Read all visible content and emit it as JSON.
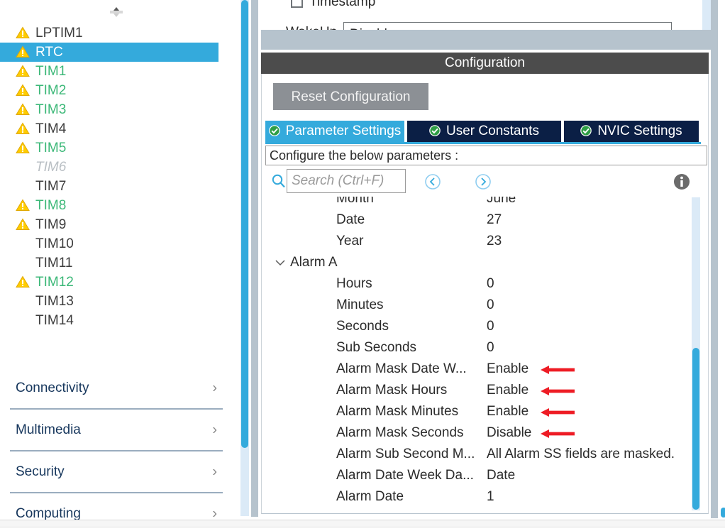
{
  "sidebar": {
    "splitter_name": "splitter-handle",
    "peripherals": [
      {
        "label": "LPTIM1",
        "warn": true,
        "state": "normal",
        "selected": false
      },
      {
        "label": "RTC",
        "warn": true,
        "state": "normal",
        "selected": true
      },
      {
        "label": "TIM1",
        "warn": true,
        "state": "green",
        "selected": false
      },
      {
        "label": "TIM2",
        "warn": true,
        "state": "green",
        "selected": false
      },
      {
        "label": "TIM3",
        "warn": true,
        "state": "green",
        "selected": false
      },
      {
        "label": "TIM4",
        "warn": true,
        "state": "normal",
        "selected": false
      },
      {
        "label": "TIM5",
        "warn": true,
        "state": "green",
        "selected": false
      },
      {
        "label": "TIM6",
        "warn": false,
        "state": "dim",
        "selected": false
      },
      {
        "label": "TIM7",
        "warn": false,
        "state": "normal",
        "selected": false
      },
      {
        "label": "TIM8",
        "warn": true,
        "state": "green",
        "selected": false
      },
      {
        "label": "TIM9",
        "warn": true,
        "state": "normal",
        "selected": false
      },
      {
        "label": "TIM10",
        "warn": false,
        "state": "normal",
        "selected": false
      },
      {
        "label": "TIM11",
        "warn": false,
        "state": "normal",
        "selected": false
      },
      {
        "label": "TIM12",
        "warn": true,
        "state": "green",
        "selected": false
      },
      {
        "label": "TIM13",
        "warn": false,
        "state": "normal",
        "selected": false
      },
      {
        "label": "TIM14",
        "warn": false,
        "state": "normal",
        "selected": false
      }
    ],
    "categories": [
      {
        "label": "Connectivity"
      },
      {
        "label": "Multimedia"
      },
      {
        "label": "Security"
      },
      {
        "label": "Computing"
      }
    ],
    "selected_color": "#34aadc",
    "green_color": "#3cb878",
    "warn_color": "#ffcc00"
  },
  "top_panel": {
    "timestamp_label": "Timestamp",
    "timestamp_checked": false,
    "wakeup_label": "WakeUp",
    "wakeup_value": "Disable"
  },
  "config": {
    "header_title": "Configuration",
    "reset_button": "Reset Configuration",
    "tabs": [
      {
        "label": "Parameter Settings",
        "active": true
      },
      {
        "label": "User Constants",
        "active": false
      },
      {
        "label": "NVIC Settings",
        "active": false
      }
    ],
    "hint": "Configure the below parameters :",
    "search_placeholder": "Search (Ctrl+F)",
    "search_value": "",
    "nav_prev_icon": "chevron-left-circle-icon",
    "nav_next_icon": "chevron-right-circle-icon",
    "info_icon": "info-icon"
  },
  "parameters": [
    {
      "name": "Month",
      "value": "June",
      "group": false,
      "arrow": false,
      "clipped_top": true
    },
    {
      "name": "Date",
      "value": "27",
      "group": false,
      "arrow": false
    },
    {
      "name": "Year",
      "value": "23",
      "group": false,
      "arrow": false
    },
    {
      "name": "Alarm A",
      "value": "",
      "group": true,
      "arrow": false
    },
    {
      "name": "Hours",
      "value": "0",
      "group": false,
      "arrow": false
    },
    {
      "name": "Minutes",
      "value": "0",
      "group": false,
      "arrow": false
    },
    {
      "name": "Seconds",
      "value": "0",
      "group": false,
      "arrow": false
    },
    {
      "name": "Sub Seconds",
      "value": "0",
      "group": false,
      "arrow": false
    },
    {
      "name": "Alarm Mask Date W...",
      "value": "Enable",
      "group": false,
      "arrow": true
    },
    {
      "name": "Alarm Mask Hours",
      "value": "Enable",
      "group": false,
      "arrow": true
    },
    {
      "name": "Alarm Mask Minutes",
      "value": "Enable",
      "group": false,
      "arrow": true
    },
    {
      "name": "Alarm Mask Seconds",
      "value": "Disable",
      "group": false,
      "arrow": true
    },
    {
      "name": "Alarm Sub Second M...",
      "value": "All Alarm SS fields are masked.",
      "group": false,
      "arrow": false
    },
    {
      "name": "Alarm Date Week Da...",
      "value": "Date",
      "group": false,
      "arrow": false
    },
    {
      "name": "Alarm Date",
      "value": "1",
      "group": false,
      "arrow": false
    }
  ],
  "colors": {
    "accent": "#34aadc",
    "tab_inactive": "#0b1f45",
    "header_bar": "#4c4c4c",
    "arrow_red": "#ee1c25",
    "divider": "#b6c3cd"
  }
}
